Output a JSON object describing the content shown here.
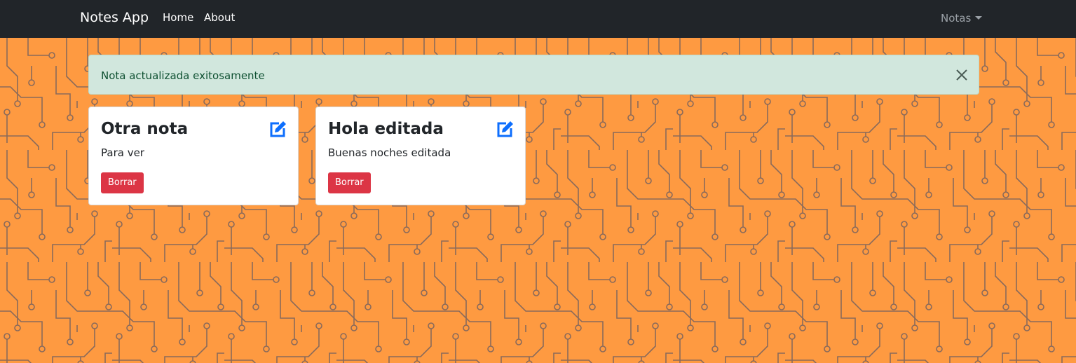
{
  "navbar": {
    "brand": "Notes App",
    "links": [
      "Home",
      "About"
    ],
    "dropdown_label": "Notas"
  },
  "alert": {
    "message": "Nota actualizada exitosamente",
    "close_icon": "close-icon"
  },
  "notes": [
    {
      "title": "Otra nota",
      "body": "Para ver",
      "delete_label": "Borrar",
      "edit_icon": "edit-icon"
    },
    {
      "title": "Hola editada",
      "body": "Buenas noches editada",
      "delete_label": "Borrar",
      "edit_icon": "edit-icon"
    }
  ],
  "colors": {
    "navbar_bg": "#212529",
    "page_bg": "#fe9a41",
    "circuit_lines": "#8a6a5a",
    "alert_bg": "#d1e7dd",
    "alert_text": "#0f5132",
    "danger": "#dc3545",
    "edit_icon": "#0d6efd"
  }
}
